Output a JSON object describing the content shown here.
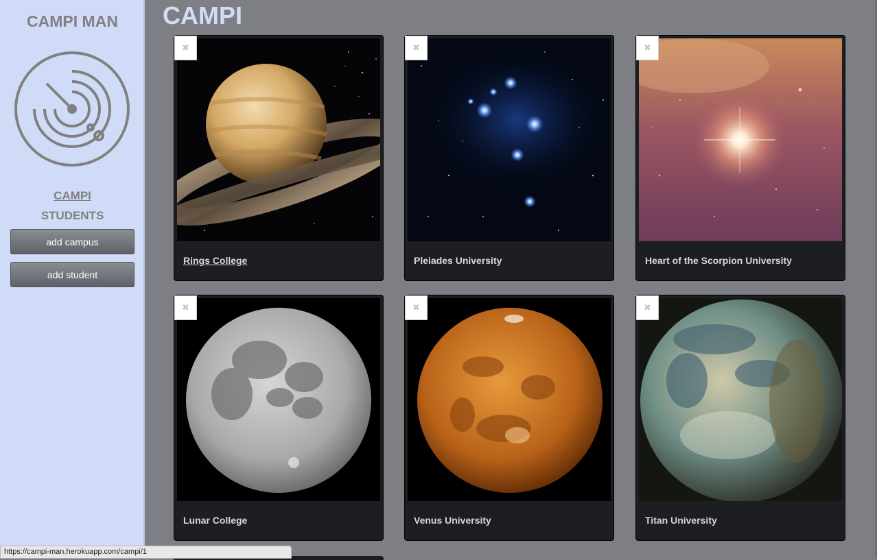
{
  "sidebar": {
    "brand": "CAMPI MAN",
    "nav": {
      "campi": "CAMPI",
      "students": "STUDENTS"
    },
    "buttons": {
      "add_campus": "add campus",
      "add_student": "add student"
    }
  },
  "main": {
    "title": "CAMPI",
    "delete_glyph": "✖",
    "campuses": [
      {
        "name": "Rings College",
        "image": "saturn"
      },
      {
        "name": "Pleiades University",
        "image": "pleiades-star-cluster"
      },
      {
        "name": "Heart of the Scorpion University",
        "image": "antares-nebula"
      },
      {
        "name": "Lunar College",
        "image": "moon"
      },
      {
        "name": "Venus University",
        "image": "venus"
      },
      {
        "name": "Titan University",
        "image": "titan"
      }
    ]
  },
  "status_bar": {
    "url": "https://campi-man.herokuapp.com/campi/1"
  },
  "colors": {
    "sidebar_bg": "#d0dcf7",
    "main_bg": "#7d7f85",
    "card_bg": "#1d1e22",
    "title": "#d2dcf8"
  }
}
